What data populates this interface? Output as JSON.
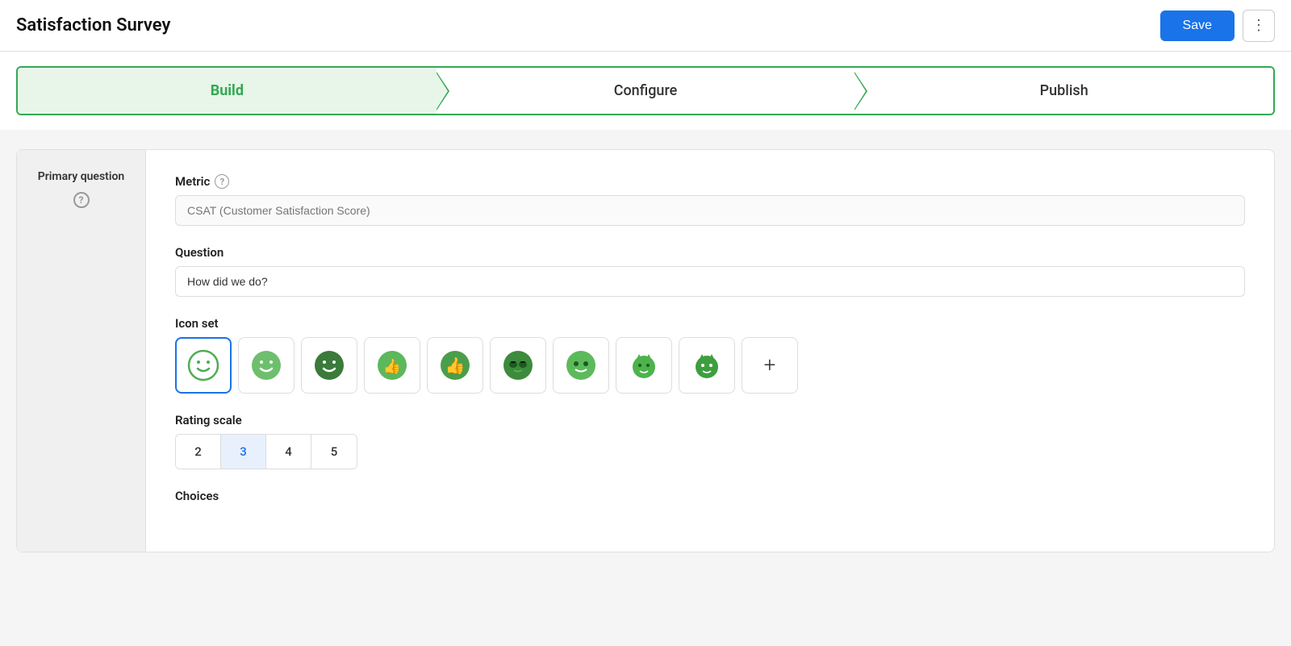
{
  "header": {
    "title": "Satisfaction Survey",
    "save_button_label": "Save",
    "more_button_label": "⋮"
  },
  "steps": [
    {
      "id": "build",
      "label": "Build",
      "active": true
    },
    {
      "id": "configure",
      "label": "Configure",
      "active": false
    },
    {
      "id": "publish",
      "label": "Publish",
      "active": false
    }
  ],
  "sidebar": {
    "item_label": "Primary question",
    "help_text": "?"
  },
  "form": {
    "metric": {
      "label": "Metric",
      "placeholder": "CSAT (Customer Satisfaction Score)",
      "value": ""
    },
    "question": {
      "label": "Question",
      "value": "How did we do?"
    },
    "icon_set": {
      "label": "Icon set",
      "icons": [
        {
          "id": "smiley-outline",
          "emoji": "🙂",
          "selected": true
        },
        {
          "id": "smiley-filled",
          "emoji": "😊",
          "selected": false
        },
        {
          "id": "smiley-dark",
          "emoji": "🌑",
          "selected": false
        },
        {
          "id": "thumbs-small",
          "emoji": "👍",
          "selected": false
        },
        {
          "id": "thumbs-medium",
          "emoji": "👍",
          "selected": false
        },
        {
          "id": "monster-sunglasses",
          "emoji": "👾",
          "selected": false
        },
        {
          "id": "monster-cool",
          "emoji": "🐸",
          "selected": false
        },
        {
          "id": "cat-1",
          "emoji": "🐱",
          "selected": false
        },
        {
          "id": "cat-2",
          "emoji": "🐱",
          "selected": false
        },
        {
          "id": "add",
          "emoji": "+",
          "selected": false,
          "is_add": true
        }
      ]
    },
    "rating_scale": {
      "label": "Rating scale",
      "options": [
        {
          "value": "2",
          "selected": false
        },
        {
          "value": "3",
          "selected": true
        },
        {
          "value": "4",
          "selected": false
        },
        {
          "value": "5",
          "selected": false
        }
      ]
    },
    "choices": {
      "label": "Choices"
    }
  },
  "colors": {
    "green_active": "#34a853",
    "blue_selected": "#1a73e8",
    "save_bg": "#1a73e8"
  }
}
